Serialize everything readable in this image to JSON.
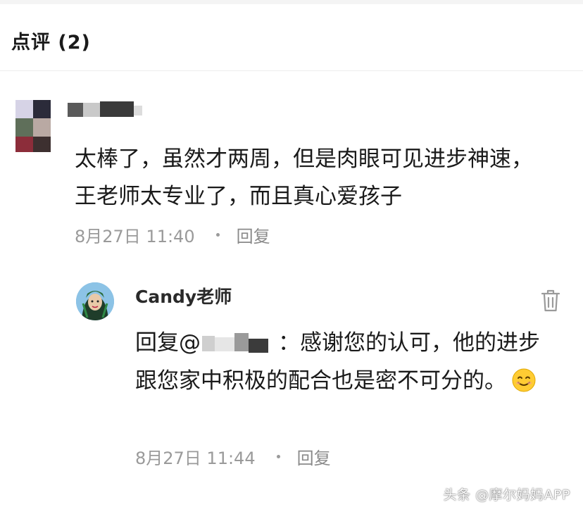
{
  "header": {
    "title": "点评 (2)"
  },
  "comment": {
    "text": "太棒了，虽然才两周，但是肉眼可见进步神速，王老师太专业了，而且真心爱孩子",
    "time": "8月27日 11:40",
    "reply_label": "回复"
  },
  "reply": {
    "author": "Candy老师",
    "prefix": "回复@",
    "text": "：感谢您的认可，他的进步跟您家中积极的配合也是密不可分的。",
    "emoji": "smiling-face",
    "time": "8月27日 11:44",
    "reply_label": "回复"
  },
  "watermark": "头条 @摩尔妈妈APP",
  "colors": {
    "meta_text": "#999999",
    "primary_text": "#1a1a1a",
    "divider": "#ececec"
  }
}
